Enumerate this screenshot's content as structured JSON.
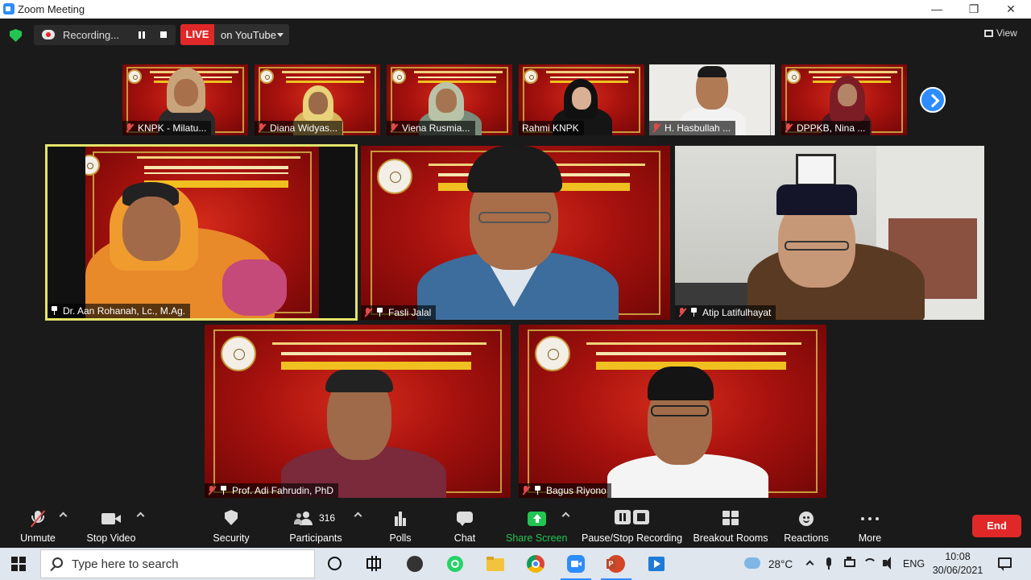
{
  "window": {
    "title": "Zoom Meeting",
    "minimize": "—",
    "maximize": "❐",
    "close": "✕"
  },
  "top_bar": {
    "recording_label": "Recording...",
    "live_label": "LIVE",
    "stream_target": "on YouTube",
    "view_label": "View"
  },
  "thumbnails": [
    {
      "name": "KNPK - Milatu..."
    },
    {
      "name": "Diana Widyas..."
    },
    {
      "name": "Viena Rusmia..."
    },
    {
      "name": "Rahmi KNPK"
    },
    {
      "name": "H. Hasbullah ..."
    },
    {
      "name": "DPPKB, Nina ..."
    }
  ],
  "gallery": [
    {
      "name": "Dr. Aan Rohanah, Lc., M.Ag.",
      "active_speaker": true
    },
    {
      "name": "Fasli Jalal",
      "active_speaker": false
    },
    {
      "name": "Atip Latifulhayat",
      "active_speaker": false
    },
    {
      "name": "Prof. Adi Fahrudin, PhD",
      "active_speaker": false
    },
    {
      "name": "Bagus Riyono",
      "active_speaker": false
    }
  ],
  "toolbar": {
    "unmute": "Unmute",
    "stop_video": "Stop Video",
    "security": "Security",
    "participants": "Participants",
    "participants_count": "316",
    "polls": "Polls",
    "chat": "Chat",
    "share_screen": "Share Screen",
    "pause_stop_recording": "Pause/Stop Recording",
    "breakout_rooms": "Breakout Rooms",
    "reactions": "Reactions",
    "more": "More",
    "end": "End"
  },
  "taskbar": {
    "search_placeholder": "Type here to search",
    "weather": "28°C",
    "language": "ENG",
    "time": "10:08",
    "date": "30/06/2021"
  },
  "colors": {
    "accent": "#2d8cff",
    "live_red": "#e02828",
    "active_speaker_border": "#e4e46a",
    "share_green": "#23c552"
  }
}
